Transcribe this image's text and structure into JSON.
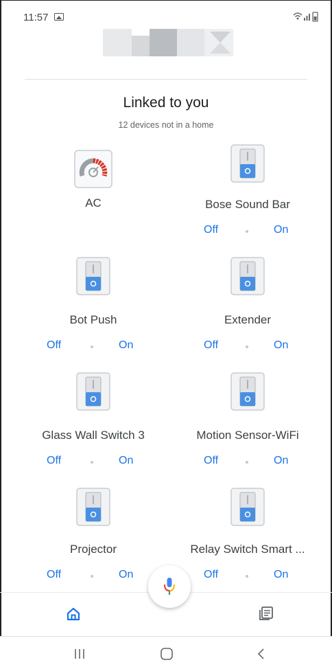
{
  "status_bar": {
    "time": "11:57",
    "icons": [
      "image-icon",
      "wifi-icon",
      "signal-icon",
      "battery-icon"
    ]
  },
  "header": {
    "title": "Linked to you",
    "subtitle": "12 devices not in a home"
  },
  "controls": {
    "off_label": "Off",
    "on_label": "On"
  },
  "devices": [
    {
      "name": "AC",
      "icon": "gauge-icon"
    },
    {
      "name": "Bose Sound Bar",
      "icon": "switch-icon"
    },
    {
      "name": "Bot Push",
      "icon": "switch-icon"
    },
    {
      "name": "Extender",
      "icon": "switch-icon"
    },
    {
      "name": "Glass Wall Switch 3",
      "icon": "switch-icon"
    },
    {
      "name": "Motion Sensor-WiFi",
      "icon": "switch-icon"
    },
    {
      "name": "Projector",
      "icon": "switch-icon"
    },
    {
      "name": "Relay Switch Smart ...",
      "icon": "switch-icon"
    }
  ],
  "bottom_nav": {
    "items": [
      "home-icon",
      "feed-icon"
    ],
    "mic": "mic-icon"
  },
  "colors": {
    "accent": "#1a73e8",
    "gauge_red": "#d93025",
    "gauge_gray": "#9aa0a6",
    "switch_blue": "#4a90e2"
  }
}
